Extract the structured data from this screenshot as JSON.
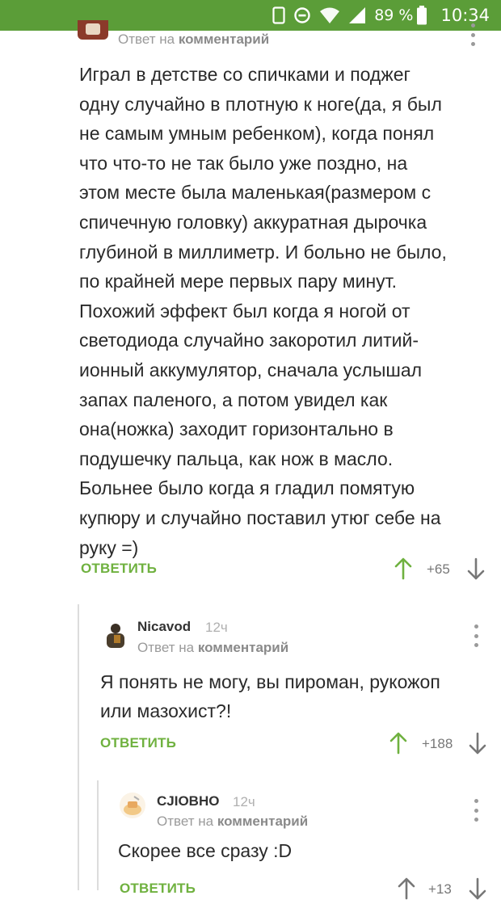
{
  "status_bar": {
    "battery": "89 %",
    "time": "10:34",
    "icons": [
      "sim-card-icon",
      "data-saver-icon",
      "wifi-icon",
      "cell-signal-icon",
      "battery-icon"
    ]
  },
  "comments": [
    {
      "reply_to_prefix": "Ответ на",
      "reply_to_link": "комментарий",
      "text_lines": [
        "Играл в детстве со спичками и поджег",
        "одну случайно в плотную к ноге(да, я был",
        "не самым умным ребенком), когда понял",
        "что что-то не так было уже поздно, на",
        "этом месте была маленькая(размером с",
        "спичечную головку) аккуратная дырочка",
        "глубиной в миллиметр. И больно не было,",
        "по крайней мере первых пару минут.",
        "Похожий эффект был когда я ногой от",
        "светодиода случайно закоротил литий-",
        "ионный аккумулятор, сначала услышал",
        "запах паленого, а потом увидел как",
        "она(ножка) заходит горизонтально в",
        "подушечку пальца, как нож в масло.",
        "Больнее было когда я гладил помятую",
        "купюру и случайно поставил утюг себе на",
        "руку =)"
      ],
      "reply_label": "ОТВЕТИТЬ",
      "score": "+65"
    },
    {
      "author": "Nicavod",
      "time": "12ч",
      "reply_to_prefix": "Ответ на",
      "reply_to_link": "комментарий",
      "text_lines": [
        "Я понять не могу, вы пироман, рукожоп",
        "или мазохист?!"
      ],
      "reply_label": "ОТВЕТИТЬ",
      "score": "+188"
    },
    {
      "author": "CJIOBHO",
      "time": "12ч",
      "reply_to_prefix": "Ответ на",
      "reply_to_link": "комментарий",
      "text_lines": [
        "Скорее все сразу :D"
      ],
      "reply_label": "ОТВЕТИТЬ",
      "score": "+13"
    }
  ],
  "colors": {
    "status_bar": "#5b9d38",
    "accent_green": "#6fb13f",
    "muted_text": "#9a9a9a",
    "thread_line": "#dcdcdc"
  }
}
